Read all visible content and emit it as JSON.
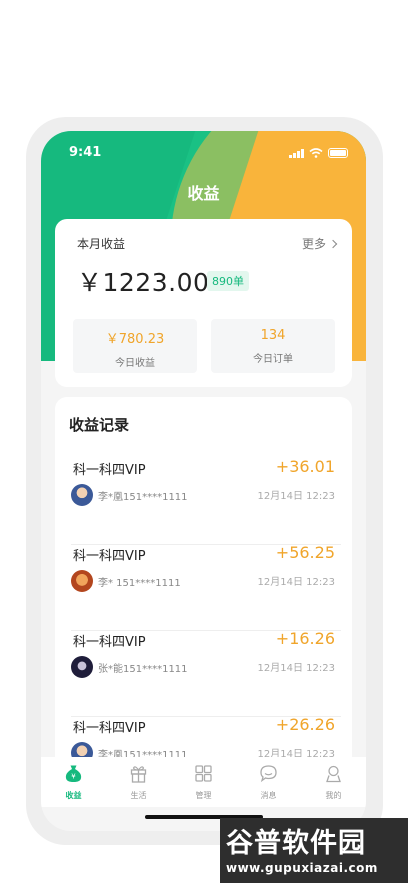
{
  "status_bar": {
    "time": "9:41"
  },
  "header": {
    "title": "收益"
  },
  "summary": {
    "title": "本月收益",
    "more_label": "更多",
    "amount": "￥1223.00",
    "order_badge": "890单",
    "stats": [
      {
        "value": "￥780.23",
        "label": "今日收益"
      },
      {
        "value": "134",
        "label": "今日订单"
      }
    ]
  },
  "records": {
    "title": "收益记录",
    "items": [
      {
        "name": "科一科四VIP",
        "amount": "+36.01",
        "user": "李*凰151****1111",
        "time": "12月14日 12:23"
      },
      {
        "name": "科一科四VIP",
        "amount": "+56.25",
        "user": "李* 151****1111",
        "time": "12月14日 12:23"
      },
      {
        "name": "科一科四VIP",
        "amount": "+16.26",
        "user": "张*能151****1111",
        "time": "12月14日 12:23"
      },
      {
        "name": "科一科四VIP",
        "amount": "+26.26",
        "user": "李*凰151****1111",
        "time": "12月14日 12:23"
      }
    ]
  },
  "tabs": [
    {
      "label": "收益",
      "icon": "income-bag-icon",
      "active": true
    },
    {
      "label": "生活",
      "icon": "gift-icon",
      "active": false
    },
    {
      "label": "管理",
      "icon": "grid-icon",
      "active": false
    },
    {
      "label": "消息",
      "icon": "chat-bubble-icon",
      "active": false
    },
    {
      "label": "我的",
      "icon": "user-icon",
      "active": false
    }
  ],
  "watermark": {
    "title": "谷普软件园",
    "url": "www.gupuxiazai.com"
  },
  "colors": {
    "primary_green": "#16b97e",
    "accent_orange": "#f9b43b",
    "amount_orange": "#f0a52b"
  }
}
